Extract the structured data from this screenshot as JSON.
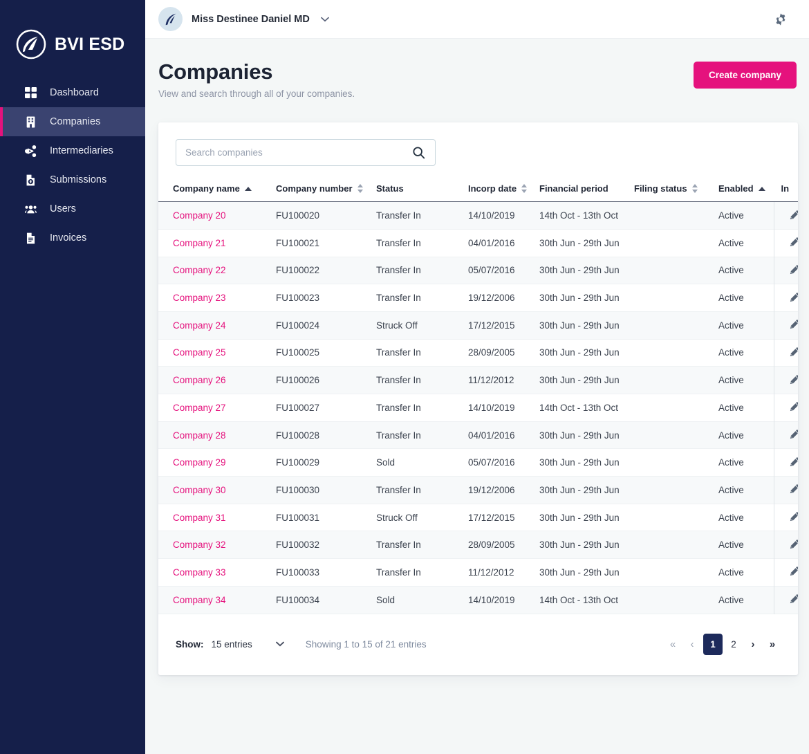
{
  "brand": {
    "name": "BVI ESD",
    "logo_icon": "feather-circle-icon"
  },
  "sidebar": {
    "items": [
      {
        "label": "Dashboard",
        "icon": "grid-icon"
      },
      {
        "label": "Companies",
        "icon": "building-icon"
      },
      {
        "label": "Intermediaries",
        "icon": "share-nodes-icon"
      },
      {
        "label": "Submissions",
        "icon": "file-upload-icon"
      },
      {
        "label": "Users",
        "icon": "users-icon"
      },
      {
        "label": "Invoices",
        "icon": "file-icon"
      }
    ],
    "active_index": 1
  },
  "topbar": {
    "user_name": "Miss Destinee Daniel MD",
    "avatar_icon": "feather-icon",
    "caret_icon": "chevron-down-icon",
    "settings_icon": "gear-icon"
  },
  "page": {
    "title": "Companies",
    "subtitle": "View and search through all of your companies.",
    "create_button": "Create company"
  },
  "search": {
    "placeholder": "Search companies",
    "value": "",
    "icon": "search-icon"
  },
  "table": {
    "columns": [
      {
        "label": "Company name",
        "sort": "asc"
      },
      {
        "label": "Company number",
        "sort": "both"
      },
      {
        "label": "Status",
        "sort": "none"
      },
      {
        "label": "Incorp date",
        "sort": "both"
      },
      {
        "label": "Financial period",
        "sort": "none"
      },
      {
        "label": "Filing status",
        "sort": "both"
      },
      {
        "label": "Enabled",
        "sort": "asc"
      },
      {
        "label": "In",
        "sort": "none"
      }
    ],
    "rows": [
      {
        "name": "Company 20",
        "number": "FU100020",
        "status": "Transfer In",
        "incorp": "14/10/2019",
        "financial": "14th Oct - 13th Oct",
        "filing": "",
        "enabled": "Active",
        "action_icon": "pencil-icon"
      },
      {
        "name": "Company 21",
        "number": "FU100021",
        "status": "Transfer In",
        "incorp": "04/01/2016",
        "financial": "30th Jun - 29th Jun",
        "filing": "",
        "enabled": "Active",
        "action_icon": "pencil-icon"
      },
      {
        "name": "Company 22",
        "number": "FU100022",
        "status": "Transfer In",
        "incorp": "05/07/2016",
        "financial": "30th Jun - 29th Jun",
        "filing": "",
        "enabled": "Active",
        "action_icon": "pencil-icon"
      },
      {
        "name": "Company 23",
        "number": "FU100023",
        "status": "Transfer In",
        "incorp": "19/12/2006",
        "financial": "30th Jun - 29th Jun",
        "filing": "",
        "enabled": "Active",
        "action_icon": "pencil-icon"
      },
      {
        "name": "Company 24",
        "number": "FU100024",
        "status": "Struck Off",
        "incorp": "17/12/2015",
        "financial": "30th Jun - 29th Jun",
        "filing": "",
        "enabled": "Active",
        "action_icon": "pencil-icon"
      },
      {
        "name": "Company 25",
        "number": "FU100025",
        "status": "Transfer In",
        "incorp": "28/09/2005",
        "financial": "30th Jun - 29th Jun",
        "filing": "",
        "enabled": "Active",
        "action_icon": "pencil-icon"
      },
      {
        "name": "Company 26",
        "number": "FU100026",
        "status": "Transfer In",
        "incorp": "11/12/2012",
        "financial": "30th Jun - 29th Jun",
        "filing": "",
        "enabled": "Active",
        "action_icon": "pencil-icon"
      },
      {
        "name": "Company 27",
        "number": "FU100027",
        "status": "Transfer In",
        "incorp": "14/10/2019",
        "financial": "14th Oct - 13th Oct",
        "filing": "",
        "enabled": "Active",
        "action_icon": "pencil-icon"
      },
      {
        "name": "Company 28",
        "number": "FU100028",
        "status": "Transfer In",
        "incorp": "04/01/2016",
        "financial": "30th Jun - 29th Jun",
        "filing": "",
        "enabled": "Active",
        "action_icon": "pencil-icon"
      },
      {
        "name": "Company 29",
        "number": "FU100029",
        "status": "Sold",
        "incorp": "05/07/2016",
        "financial": "30th Jun - 29th Jun",
        "filing": "",
        "enabled": "Active",
        "action_icon": "pencil-icon"
      },
      {
        "name": "Company 30",
        "number": "FU100030",
        "status": "Transfer In",
        "incorp": "19/12/2006",
        "financial": "30th Jun - 29th Jun",
        "filing": "",
        "enabled": "Active",
        "action_icon": "pencil-icon"
      },
      {
        "name": "Company 31",
        "number": "FU100031",
        "status": "Struck Off",
        "incorp": "17/12/2015",
        "financial": "30th Jun - 29th Jun",
        "filing": "",
        "enabled": "Active",
        "action_icon": "pencil-icon"
      },
      {
        "name": "Company 32",
        "number": "FU100032",
        "status": "Transfer In",
        "incorp": "28/09/2005",
        "financial": "30th Jun - 29th Jun",
        "filing": "",
        "enabled": "Active",
        "action_icon": "pencil-icon"
      },
      {
        "name": "Company 33",
        "number": "FU100033",
        "status": "Transfer In",
        "incorp": "11/12/2012",
        "financial": "30th Jun - 29th Jun",
        "filing": "",
        "enabled": "Active",
        "action_icon": "pencil-icon"
      },
      {
        "name": "Company 34",
        "number": "FU100034",
        "status": "Sold",
        "incorp": "14/10/2019",
        "financial": "14th Oct - 13th Oct",
        "filing": "",
        "enabled": "Active",
        "action_icon": "pencil-icon"
      }
    ]
  },
  "footer": {
    "show_label": "Show:",
    "entries_value": "15 entries",
    "showing_text": "Showing 1 to 15 of 21 entries",
    "pagination": {
      "first": "«",
      "prev": "‹",
      "pages": [
        "1",
        "2"
      ],
      "current": "1",
      "next": "›",
      "last": "»"
    }
  },
  "colors": {
    "sidebar_bg": "#151f4a",
    "sidebar_active": "#3a4370",
    "accent_pink": "#e5127d",
    "page_bg": "#f4f7f7",
    "pager_active": "#1d2a5b"
  }
}
